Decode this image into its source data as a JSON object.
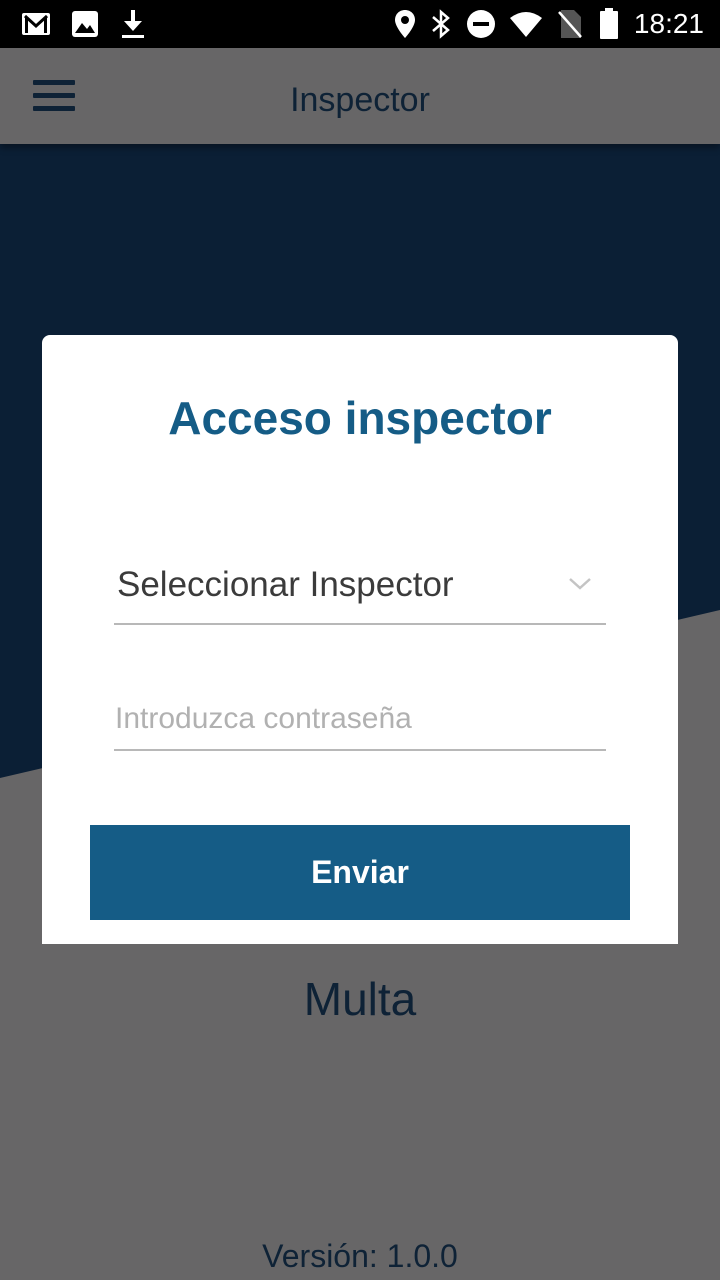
{
  "status_bar": {
    "time": "18:21",
    "left_icons": [
      "gmail-icon",
      "image-icon",
      "download-icon"
    ],
    "right_icons": [
      "location-icon",
      "bluetooth-icon",
      "do-not-disturb-icon",
      "wifi-icon",
      "no-sim-icon",
      "battery-icon"
    ]
  },
  "toolbar": {
    "title": "Inspector",
    "menu_icon": "hamburger-menu-icon"
  },
  "dialog": {
    "title": "Acceso inspector",
    "inspector_select": {
      "selected_value": "Seleccionar Inspector",
      "icon": "chevron-down-icon"
    },
    "password": {
      "value": "",
      "placeholder": "Introduzca contraseña"
    },
    "submit_label": "Enviar"
  },
  "app_name": "Multa",
  "version": "Versión: 1.0.0",
  "colors": {
    "primary": "#155c86",
    "dark_navy": "#0b1f35",
    "gray_background": "#676667",
    "status_bar": "#000000"
  }
}
